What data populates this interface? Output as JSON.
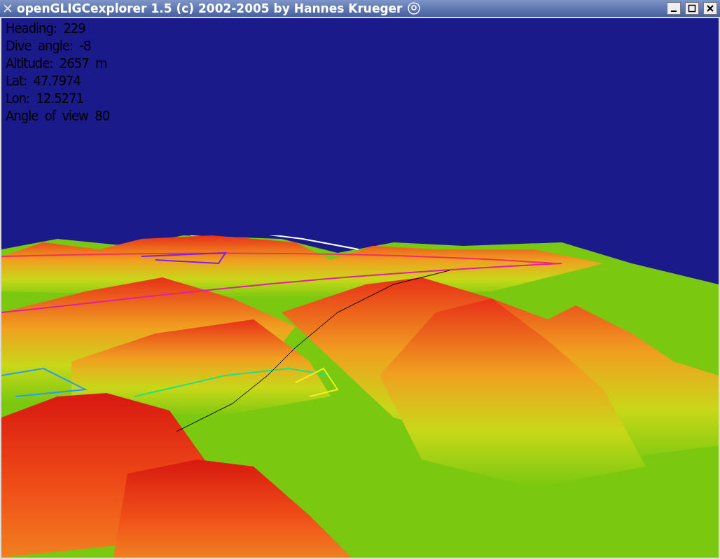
{
  "window": {
    "title": "openGLIGCexplorer 1.5 (c) 2002-2005 by Hannes Krueger"
  },
  "hud": [
    "Heading:  229",
    "Dive  angle:  -8",
    "Altitude:  2657  m",
    "Lat:  47.7974",
    "Lon:  12.5271",
    "Angle  of  view  80"
  ]
}
